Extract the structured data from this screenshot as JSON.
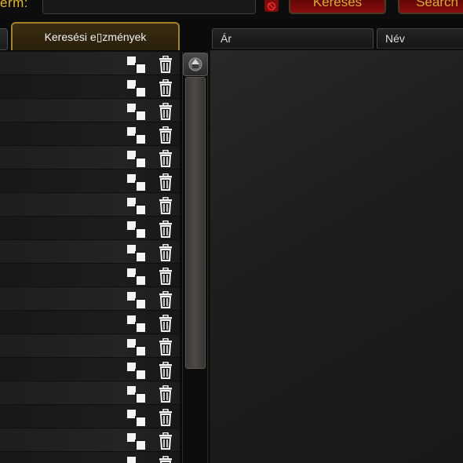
{
  "search": {
    "term_label": "erm:",
    "term_value": "",
    "search_button": "Keresés",
    "search2_button": "Search"
  },
  "tabs": {
    "history_label": "Keresési e▯zmények"
  },
  "columns": {
    "price": "Ár",
    "name": "Név"
  },
  "history": {
    "rows": [
      "",
      "",
      "",
      "",
      "",
      "",
      "",
      "",
      "",
      "",
      "",
      "",
      "",
      "",
      "",
      "",
      "",
      ""
    ]
  },
  "icons": {
    "row_copy": "copy-icon",
    "row_delete": "trash-icon",
    "clear": "no-sign-icon",
    "scroll_up": "arrow-up-icon"
  },
  "colors": {
    "accent_gold": "#e3b62a",
    "button_red": "#890e0e",
    "tab_border": "#a68128"
  }
}
